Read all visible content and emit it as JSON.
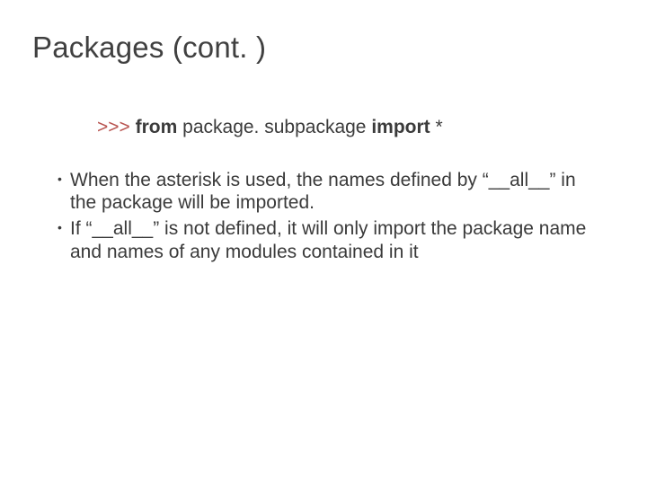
{
  "title": "Packages (cont. )",
  "code": {
    "prompt": ">>>",
    "kw_from": "from",
    "module": "package. subpackage",
    "kw_import": "import",
    "star": "*"
  },
  "bullets": [
    "When the asterisk is used, the names defined by “__all__” in the package will be imported.",
    "If “__all__” is not defined, it will only import the package name and names of any modules contained in it"
  ]
}
